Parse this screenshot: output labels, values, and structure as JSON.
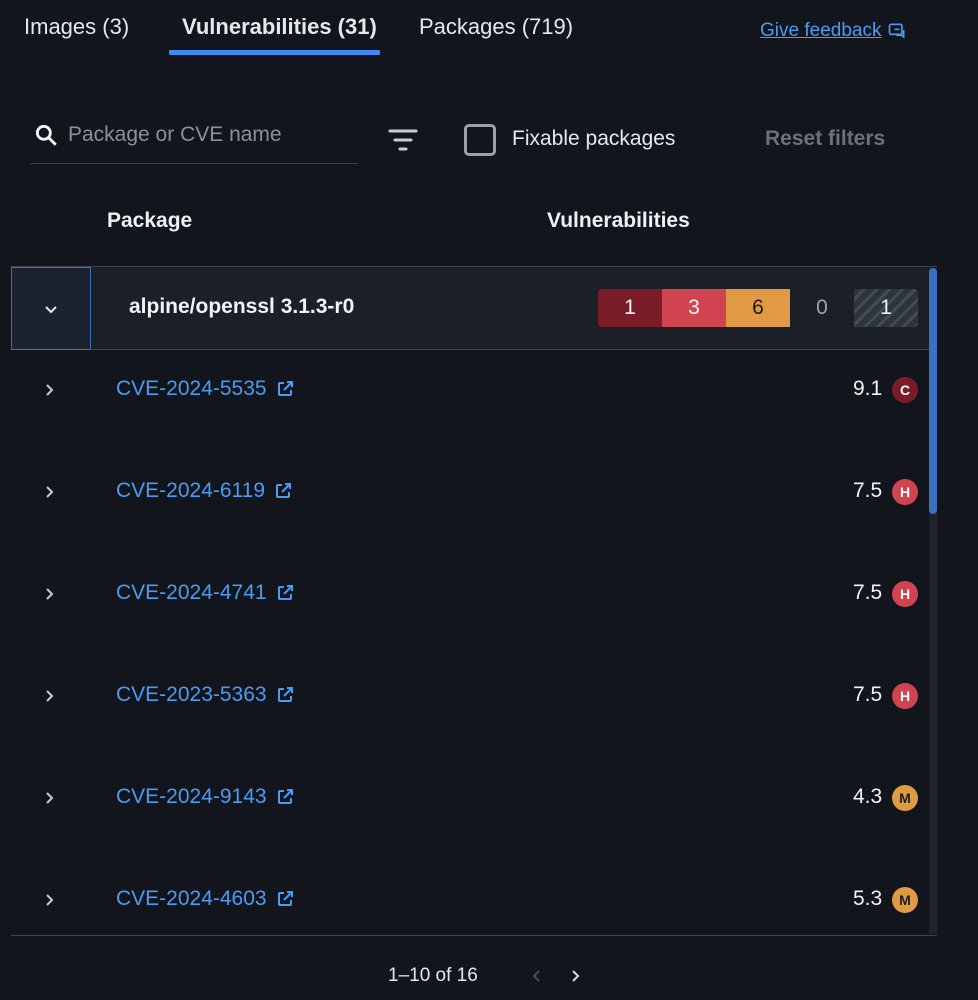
{
  "tabs": [
    {
      "label": "Images (3)"
    },
    {
      "label": "Vulnerabilities (31)"
    },
    {
      "label": "Packages (719)"
    }
  ],
  "feedback_label": "Give feedback",
  "search": {
    "placeholder": "Package or CVE name",
    "value": ""
  },
  "fixable_label": "Fixable packages",
  "fixable_checked": false,
  "reset_label": "Reset filters",
  "columns": {
    "package": "Package",
    "vulnerabilities": "Vulnerabilities"
  },
  "package": {
    "name": "alpine/openssl 3.1.3-r0",
    "counts": {
      "critical": "1",
      "high": "3",
      "medium": "6",
      "low": "0",
      "unspecified": "1"
    }
  },
  "cves": [
    {
      "id": "CVE-2024-5535",
      "score": "9.1",
      "severity": "C",
      "color": "#7a1c27"
    },
    {
      "id": "CVE-2024-6119",
      "score": "7.5",
      "severity": "H",
      "color": "#cf4450"
    },
    {
      "id": "CVE-2024-4741",
      "score": "7.5",
      "severity": "H",
      "color": "#cf4450"
    },
    {
      "id": "CVE-2023-5363",
      "score": "7.5",
      "severity": "H",
      "color": "#cf4450"
    },
    {
      "id": "CVE-2024-9143",
      "score": "4.3",
      "severity": "M",
      "color": "#e09a43"
    },
    {
      "id": "CVE-2024-4603",
      "score": "5.3",
      "severity": "M",
      "color": "#e09a43"
    }
  ],
  "pagination": {
    "label": "1–10 of 16"
  },
  "colors": {
    "accent": "#3d8bf2",
    "link": "#4b9bf5",
    "background": "#12151c"
  }
}
